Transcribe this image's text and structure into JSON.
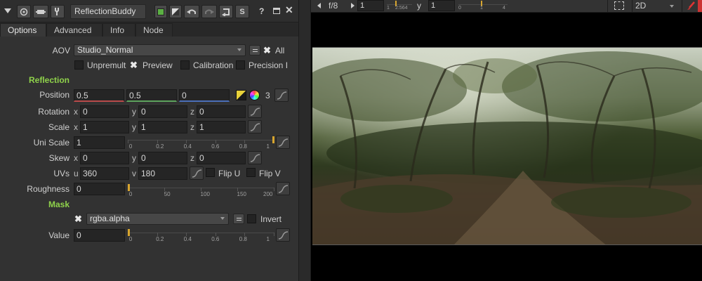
{
  "node": {
    "name": "ReflectionBuddy"
  },
  "toolbar": {
    "help_label": "?",
    "s_label": "S"
  },
  "tabs": [
    {
      "label": "Options"
    },
    {
      "label": "Advanced"
    },
    {
      "label": "Info"
    },
    {
      "label": "Node"
    }
  ],
  "aov": {
    "label": "AOV",
    "value": "Studio_Normal",
    "all_label": "All"
  },
  "checks": {
    "unpremult": "Unpremult",
    "preview": "Preview",
    "calibration": "Calibration",
    "precision": "Precision I"
  },
  "reflection": {
    "section": "Reflection",
    "position": {
      "label": "Position",
      "x": "0.5",
      "y": "0.5",
      "z": "0",
      "count": "3"
    },
    "rotation": {
      "label": "Rotation",
      "x": "0",
      "y": "0",
      "z": "0"
    },
    "scale": {
      "label": "Scale",
      "x": "1",
      "y": "1",
      "z": "1"
    },
    "uni_scale": {
      "label": "Uni Scale",
      "value": "1",
      "ticks": [
        "0",
        "0.2",
        "0.4",
        "0.6",
        "0.8",
        "1"
      ]
    },
    "skew": {
      "label": "Skew",
      "x": "0",
      "y": "0",
      "z": "0"
    },
    "uvs": {
      "label": "UVs",
      "u": "360",
      "v": "180",
      "flip_u": "Flip U",
      "flip_v": "Flip V"
    },
    "roughness": {
      "label": "Roughness",
      "value": "0",
      "ticks": [
        "0",
        "50",
        "100",
        "150",
        "200"
      ]
    }
  },
  "axes": {
    "x": "x",
    "y": "y",
    "z": "z",
    "u": "u",
    "v": "v"
  },
  "mask": {
    "section": "Mask",
    "channel": "rgba.alpha",
    "invert": "Invert",
    "value_label": "Value",
    "value": "0",
    "ticks": [
      "0",
      "0.2",
      "0.4",
      "0.6",
      "0.8",
      "1"
    ]
  },
  "viewer": {
    "fstop": "f/8",
    "frame": "1",
    "gamma_ticks": [
      "1",
      "2:564"
    ],
    "y_label": "y",
    "y_value": "1",
    "y_ticks": [
      "0",
      "1",
      "4"
    ],
    "view_mode": "2D"
  },
  "colors": {
    "accent_green": "#8fd24b",
    "slider_knob": "#d7a52e"
  }
}
